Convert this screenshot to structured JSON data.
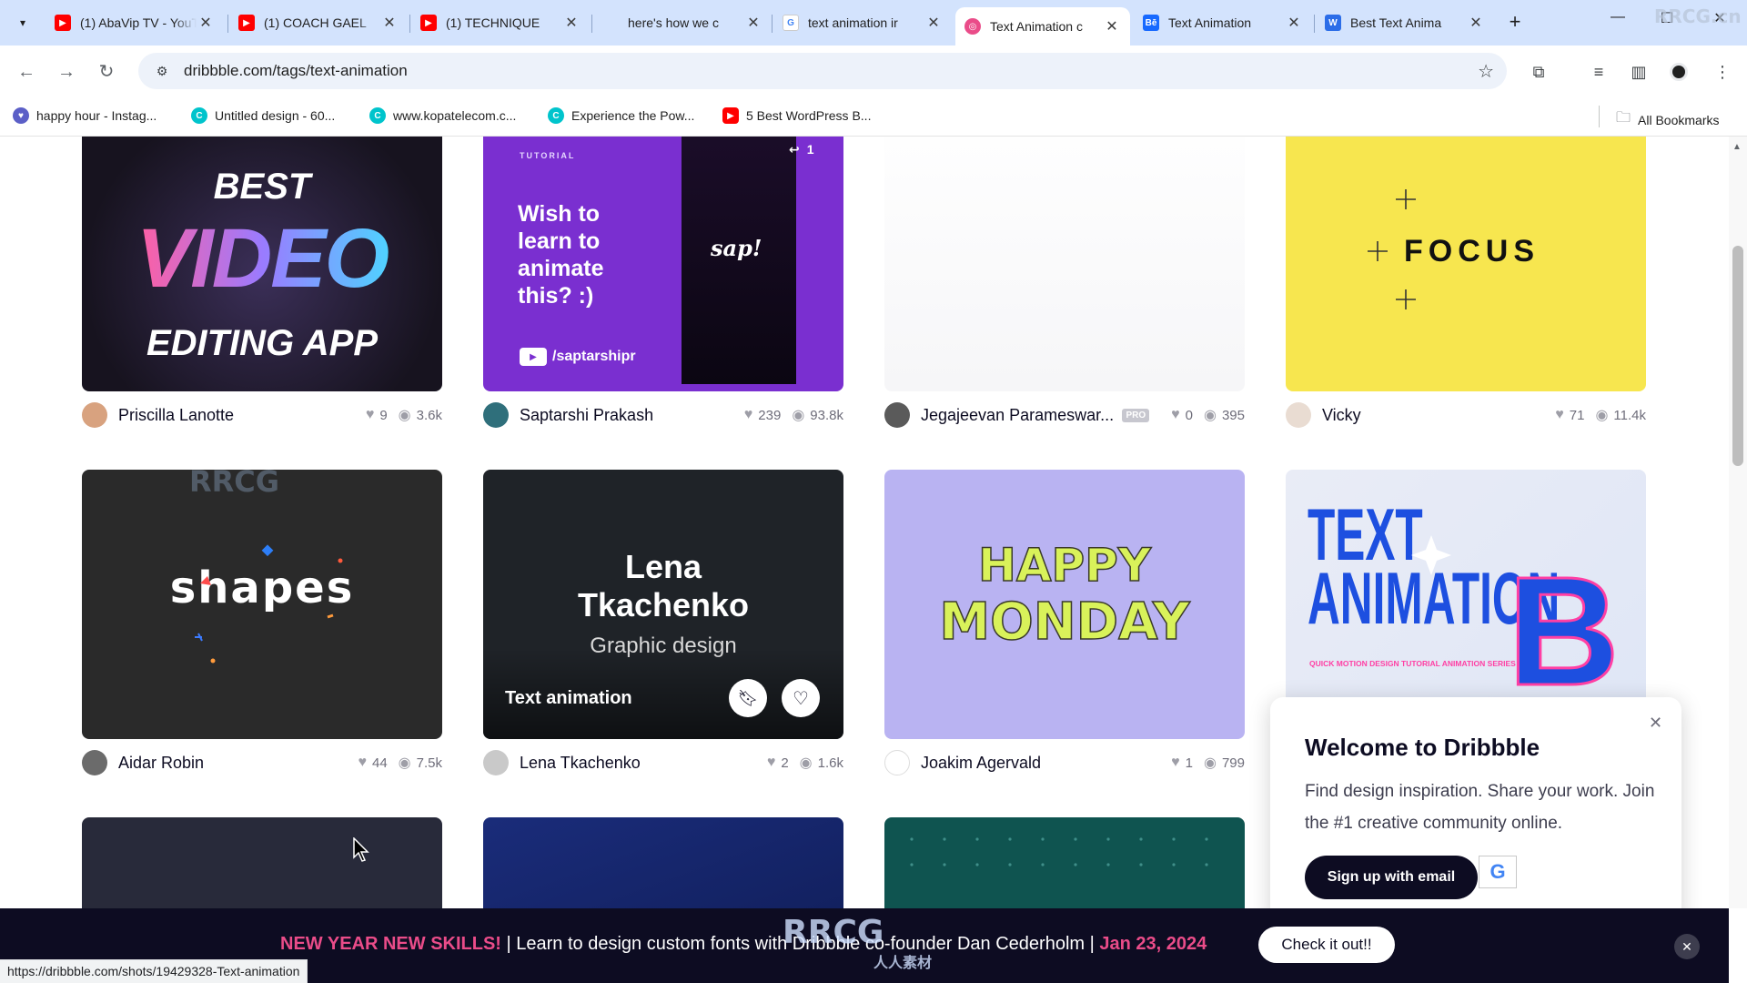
{
  "browser": {
    "tabs": [
      {
        "label": "(1) AbaVip TV - YouTube",
        "icon": "youtube-icon",
        "color": "#ff0000"
      },
      {
        "label": "(1) COACH GAEL",
        "icon": "youtube-icon",
        "color": "#ff0000"
      },
      {
        "label": "(1) TECHNIQUE",
        "icon": "youtube-icon",
        "color": "#ff0000"
      },
      {
        "label": "here's how we c",
        "icon": "blank-icon",
        "color": "#d3e3fd"
      },
      {
        "label": "text animation ir",
        "icon": "google-icon",
        "color": "#4285f4"
      },
      {
        "label": "Text Animation c",
        "icon": "dribbble-icon",
        "color": "#ea4c89"
      },
      {
        "label": "Text Animation",
        "icon": "behance-icon",
        "color": "#1769ff"
      },
      {
        "label": "Best Text Anima",
        "icon": "w-icon",
        "color": "#2b6de8"
      }
    ],
    "url": "dribbble.com/tags/text-animation",
    "bookmarks": [
      {
        "label": "happy hour - Instag...",
        "color": "#5b5fc7"
      },
      {
        "label": "Untitled design - 60...",
        "color": "#00c4cc"
      },
      {
        "label": "www.kopatelecom.c...",
        "color": "#00c4cc"
      },
      {
        "label": "Experience the Pow...",
        "color": "#00c4cc"
      },
      {
        "label": "5 Best WordPress B...",
        "color": "#ff0000"
      }
    ],
    "all_bookmarks": "All Bookmarks",
    "status_url": "https://dribbble.com/shots/19429328-Text-animation"
  },
  "shots": [
    {
      "author": "Priscilla Lanotte",
      "likes": "9",
      "views": "3.6k",
      "pro": false,
      "art": {
        "line1": "BEST",
        "line2": "VIDEO",
        "line3": "EDITING APP"
      }
    },
    {
      "author": "Saptarshi Prakash",
      "likes": "239",
      "views": "93.8k",
      "pro": false,
      "art": {
        "tag": "TUTORIAL",
        "headline": "Wish to learn to animate this? :)",
        "handle": "/saptarshipr",
        "logo": "sap!",
        "count": "1"
      }
    },
    {
      "author": "Jegajeevan Parameswar...",
      "likes": "0",
      "views": "395",
      "pro": true,
      "pro_label": "PRO",
      "art": {}
    },
    {
      "author": "Vicky",
      "likes": "71",
      "views": "11.4k",
      "pro": false,
      "art": {
        "word": "FOCUS"
      }
    },
    {
      "author": "Aidar Robin",
      "likes": "44",
      "views": "7.5k",
      "pro": false,
      "art": {
        "word": "shapes"
      }
    },
    {
      "author": "Lena Tkachenko",
      "likes": "2",
      "views": "1.6k",
      "pro": false,
      "art": {
        "name1": "Lena",
        "name2": "Tkachenko",
        "sub": "Graphic design",
        "hover_title": "Text animation"
      }
    },
    {
      "author": "Joakim Agervald",
      "likes": "1",
      "views": "799",
      "pro": false,
      "art": {
        "line1": "HAPPY",
        "line2": "MONDAY"
      }
    },
    {
      "author": "",
      "likes": "",
      "views": "",
      "pro": false,
      "art": {
        "line1": "TEXT",
        "line2": "ANIMATION",
        "letter": "B",
        "caption": "QUICK MOTION DESIGN TUTORIAL ANIMATION SERIES"
      }
    }
  ],
  "welcome": {
    "title": "Welcome to Dribbble",
    "body": "Find design inspiration. Share your work. Join the #1 creative community online.",
    "signup": "Sign up with email",
    "google": "G"
  },
  "banner": {
    "highlight": "NEW YEAR NEW SKILLS!",
    "text": " | Learn to design custom fonts with Dribbble co-founder Dan Cederholm | ",
    "date": "Jan 23, 2024",
    "button": "Check it out!!"
  },
  "watermark": {
    "brand": "RRCG",
    "sub": "人人素材",
    "corner": "RRCG.cn"
  }
}
